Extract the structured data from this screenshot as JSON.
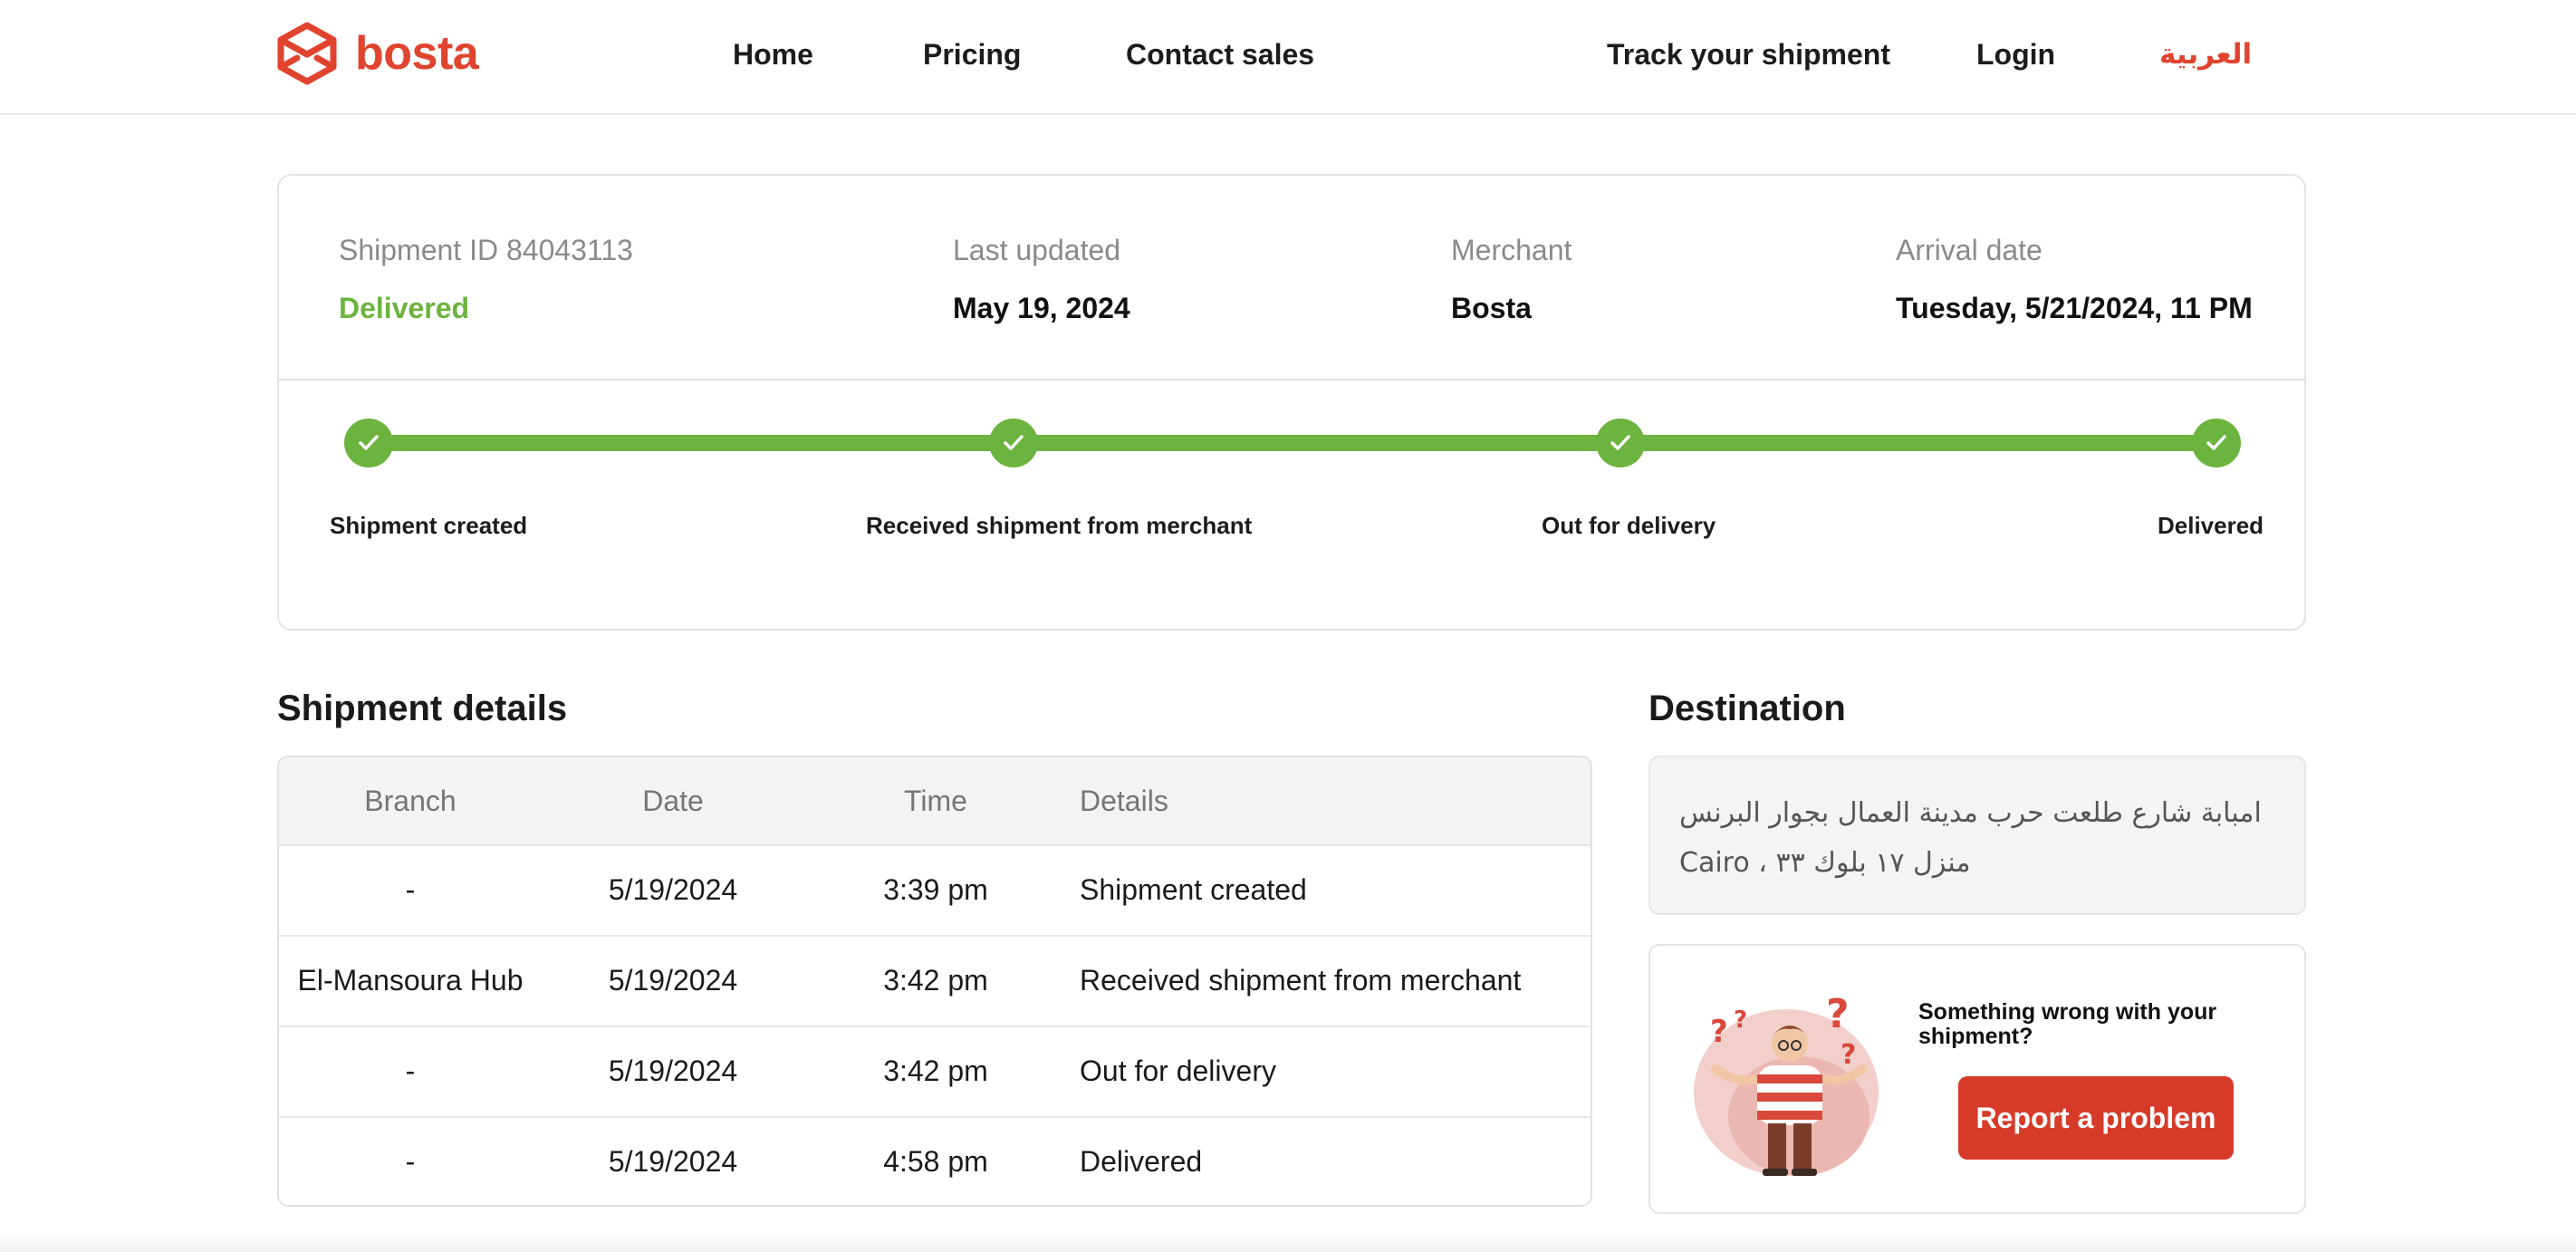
{
  "header": {
    "logo_text": "bosta",
    "nav": {
      "home": "Home",
      "pricing": "Pricing",
      "contact_sales": "Contact sales",
      "track": "Track your shipment",
      "login": "Login",
      "language": "العربية"
    }
  },
  "summary": {
    "shipment_id_label": "Shipment ID 84043113",
    "status": "Delivered",
    "last_updated_label": "Last updated",
    "last_updated_value": "May 19, 2024",
    "merchant_label": "Merchant",
    "merchant_value": "Bosta",
    "arrival_label": "Arrival date",
    "arrival_value": "Tuesday, 5/21/2024, 11 PM"
  },
  "progress": {
    "steps": [
      {
        "label": "Shipment created",
        "completed": true
      },
      {
        "label": "Received shipment from merchant",
        "completed": true
      },
      {
        "label": "Out for delivery",
        "completed": true
      },
      {
        "label": "Delivered",
        "completed": true
      }
    ]
  },
  "details": {
    "title": "Shipment details",
    "columns": [
      "Branch",
      "Date",
      "Time",
      "Details"
    ],
    "rows": [
      {
        "branch": "-",
        "date": "5/19/2024",
        "time": "3:39 pm",
        "details": "Shipment created"
      },
      {
        "branch": "El-Mansoura Hub",
        "date": "5/19/2024",
        "time": "3:42 pm",
        "details": "Received shipment from merchant"
      },
      {
        "branch": "-",
        "date": "5/19/2024",
        "time": "3:42 pm",
        "details": "Out for delivery"
      },
      {
        "branch": "-",
        "date": "5/19/2024",
        "time": "4:58 pm",
        "details": "Delivered"
      }
    ]
  },
  "destination": {
    "title": "Destination",
    "address": "امبابة شارع طلعت حرب مدينة العمال بجوار البرنس منزل ١٧ بلوك ٣٣ ، Cairo"
  },
  "problem": {
    "text": "Something wrong with your shipment?",
    "button_label": "Report a problem"
  },
  "colors": {
    "brand": "#e0432e",
    "success": "#6db33f",
    "button": "#d63b2a"
  },
  "icons": {
    "logo": "bosta-box-logo",
    "step": "check-icon"
  }
}
